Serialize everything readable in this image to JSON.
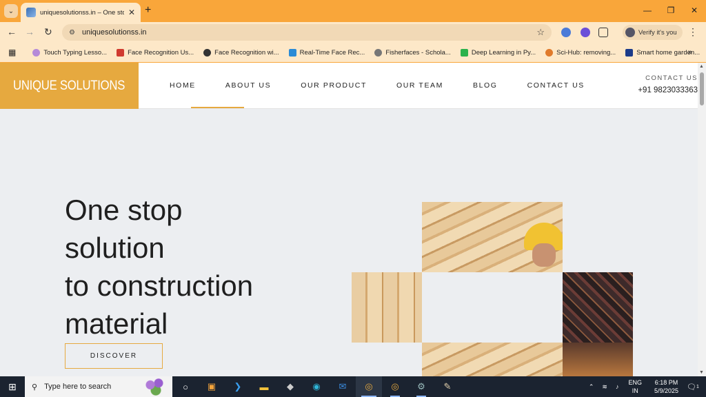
{
  "browser": {
    "tab_title": "uniquesolutionss.in – One stop",
    "tab_close": "✕",
    "new_tab": "+",
    "url": "uniquesolutionss.in",
    "verify_label": "Verify it's you",
    "window_controls": [
      "—",
      "❐",
      "✕"
    ]
  },
  "bookmarks": [
    {
      "label": "Touch Typing Lesso...",
      "color": "#b58ad8"
    },
    {
      "label": "Face Recognition Us...",
      "color": "#d03a2f"
    },
    {
      "label": "Face Recognition wi...",
      "color": "#333333"
    },
    {
      "label": "Real-Time Face Rec...",
      "color": "#2a8bd6"
    },
    {
      "label": "Fisherfaces - Schola...",
      "color": "#777777"
    },
    {
      "label": "Deep Learning in Py...",
      "color": "#2bb24c"
    },
    {
      "label": "Sci-Hub: removing...",
      "color": "#e07a2b"
    },
    {
      "label": "Smart home garden...",
      "color": "#1b3b8a"
    }
  ],
  "site": {
    "logo": "UNIQUE SOLUTIONS",
    "nav": [
      "HOME",
      "ABOUT US",
      "OUR PRODUCT",
      "OUR TEAM",
      "BLOG",
      "CONTACT US"
    ],
    "contact_label": "CONTACT US",
    "contact_phone": "+91 9823033363",
    "hero_lines": [
      {
        "light": "One ",
        "bold": "stop"
      },
      {
        "light": "",
        "bold": "solution"
      },
      {
        "light": "",
        "bold": "to construction"
      },
      {
        "light": "",
        "bold": "material"
      }
    ],
    "discover": "DISCOVER",
    "accent": "#e6a93f"
  },
  "taskbar": {
    "search_placeholder": "Type here to search",
    "lang_top": "ENG",
    "lang_bottom": "IN",
    "time": "6:18 PM",
    "date": "5/9/2025",
    "notif_count": "1"
  }
}
